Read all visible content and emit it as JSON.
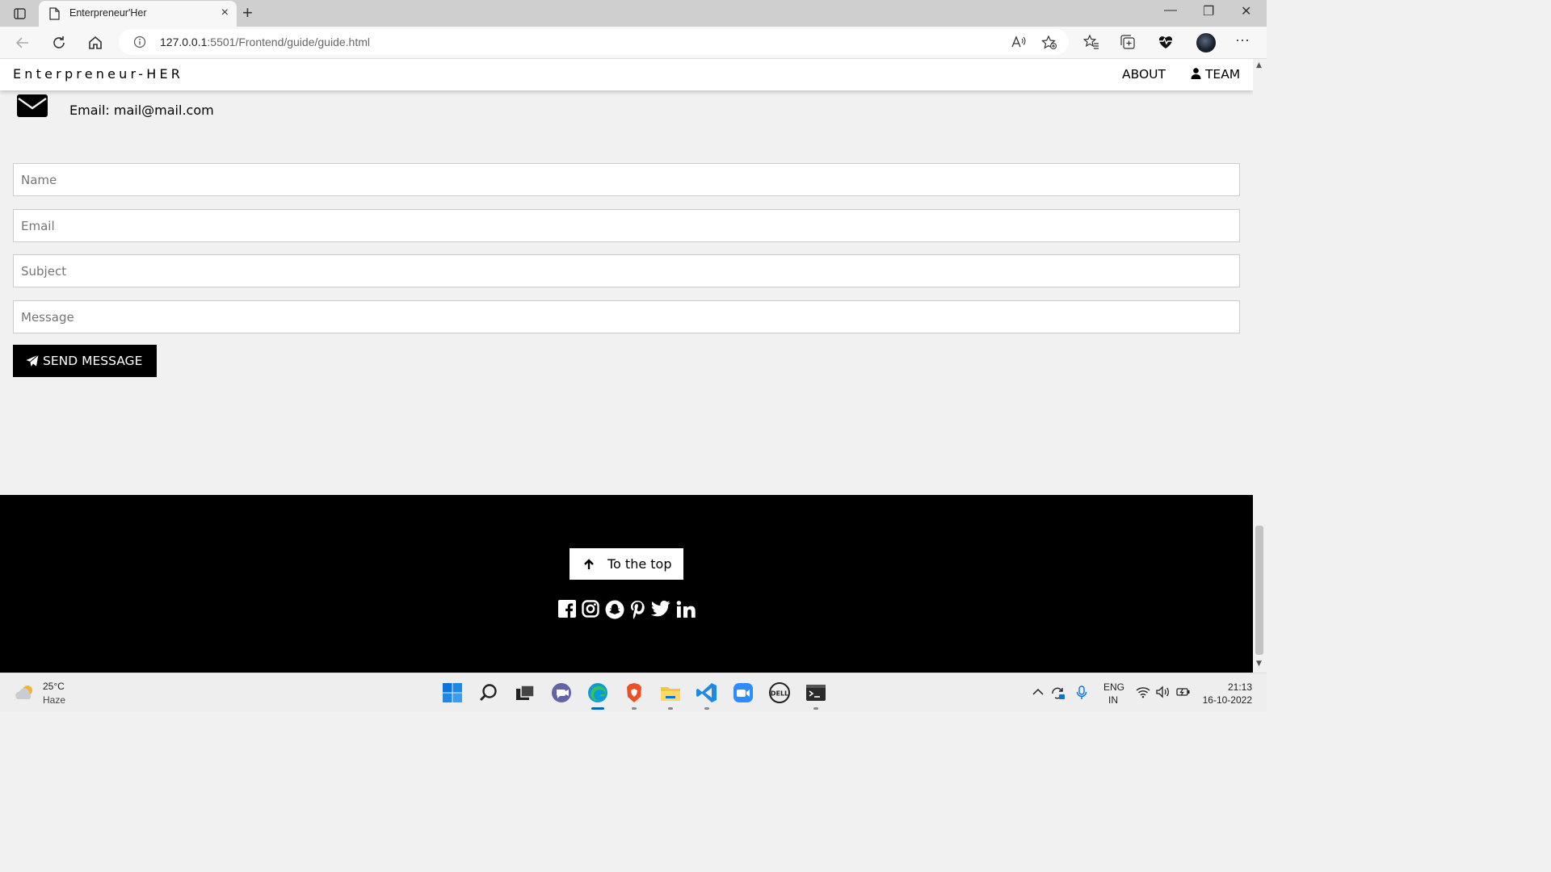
{
  "browser": {
    "tab_title": "Enterpreneur'Her",
    "new_tab_label": "+",
    "close_tab_label": "×",
    "url_host": "127.0.0.1",
    "url_rest": ":5501/Frontend/guide/guide.html",
    "window_minimize": "—",
    "window_restore": "❐",
    "window_close": "✕"
  },
  "site": {
    "brand": "Enterpreneur-HER",
    "nav": {
      "about": "ABOUT",
      "team": "TEAM"
    },
    "contact": {
      "email_label": "Email:",
      "email_value": "mail@mail.com"
    },
    "form": {
      "name_placeholder": "Name",
      "email_placeholder": "Email",
      "subject_placeholder": "Subject",
      "message_placeholder": "Message",
      "send_label": "SEND MESSAGE"
    },
    "footer": {
      "to_top_label": "To the top",
      "social_icons": [
        "facebook-icon",
        "instagram-icon",
        "snapchat-icon",
        "pinterest-icon",
        "twitter-icon",
        "linkedin-icon"
      ]
    }
  },
  "taskbar": {
    "weather_temp": "25°C",
    "weather_condition": "Haze",
    "lang_line1": "ENG",
    "lang_line2": "IN",
    "time": "21:13",
    "date": "16-10-2022"
  },
  "colors": {
    "footer_bg": "#000000",
    "send_button_bg": "#000000",
    "page_bg": "#f1f1f1",
    "edge_accent": "#0067c0"
  }
}
